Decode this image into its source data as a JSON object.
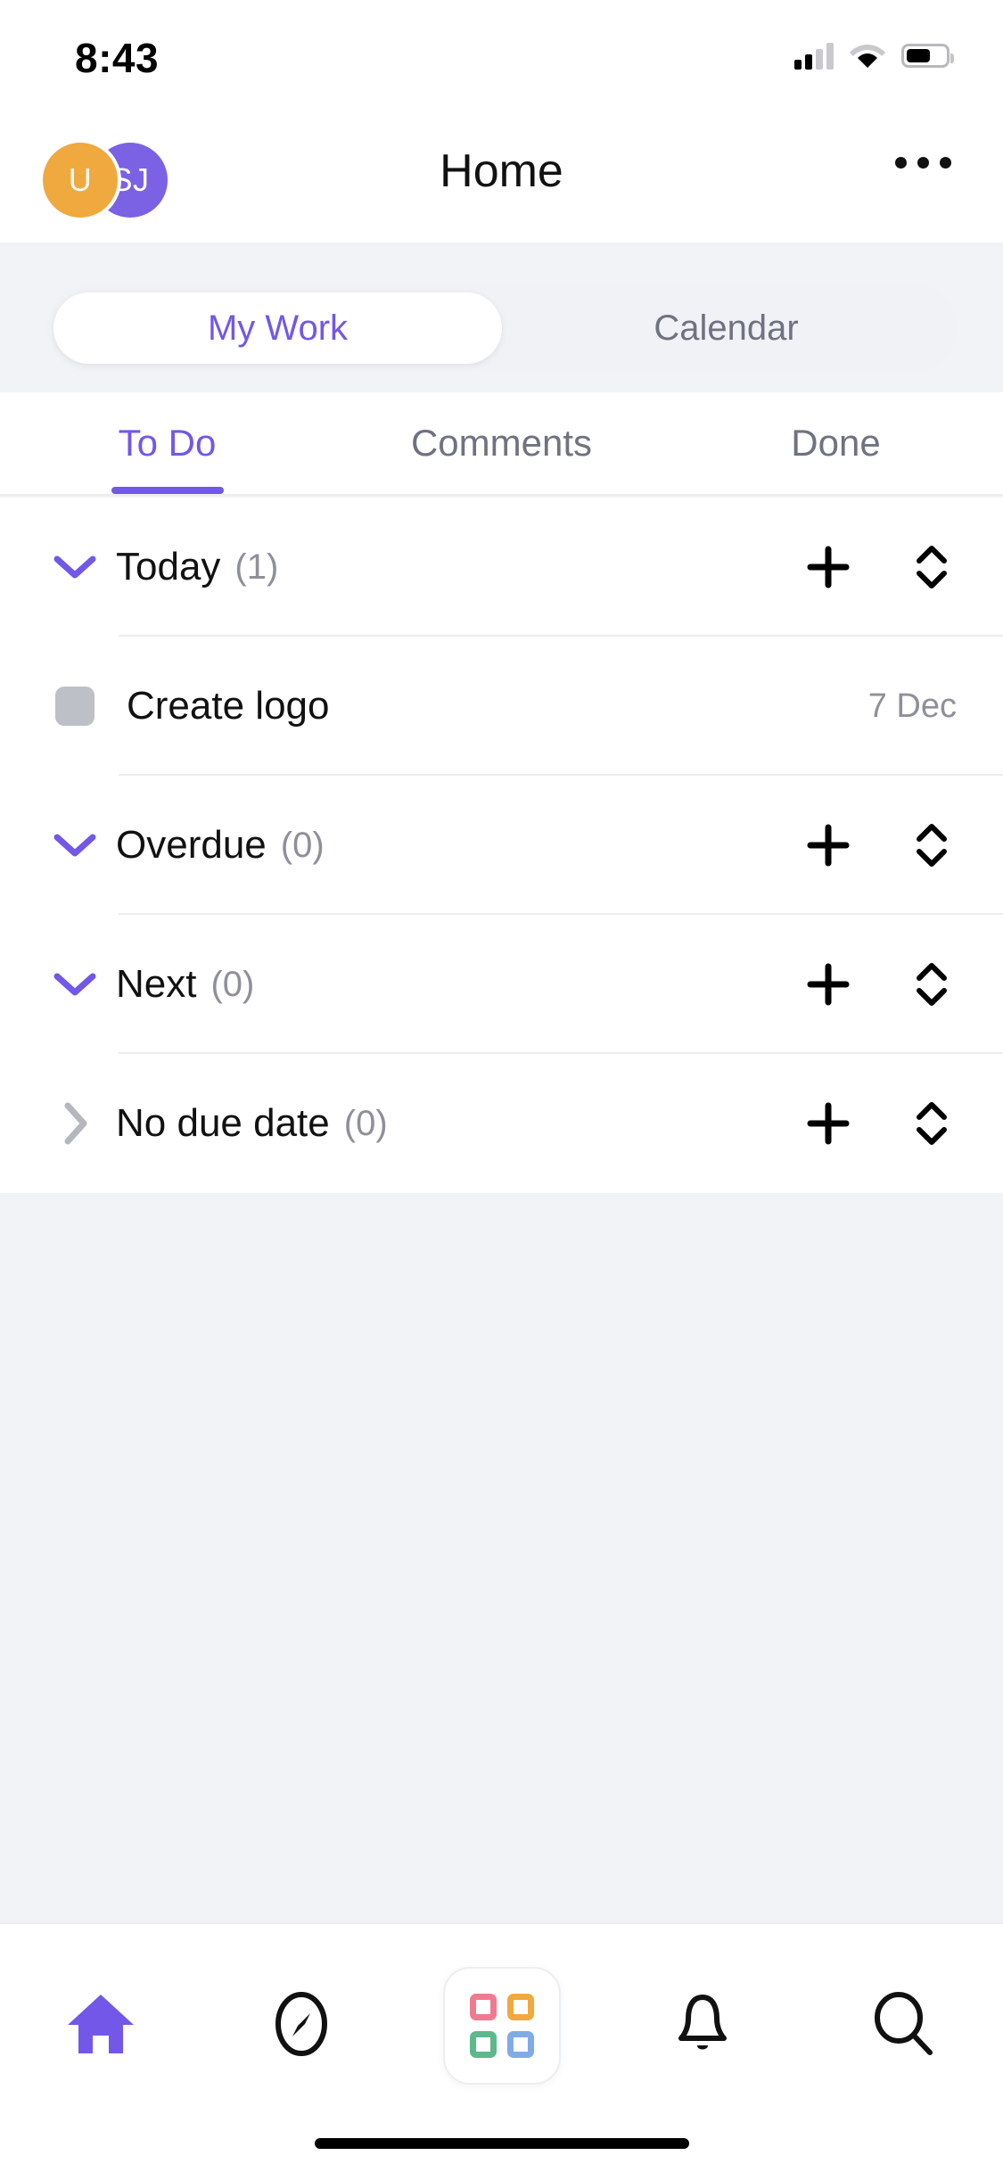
{
  "status_bar": {
    "time": "8:43",
    "icons": [
      "cellular-signal-icon",
      "wifi-icon",
      "battery-icon"
    ]
  },
  "header": {
    "title": "Home",
    "avatars": [
      {
        "initials": "U",
        "color": "#f0a93f",
        "name": "avatar-user"
      },
      {
        "initials": "SJ",
        "color": "#7b61e4",
        "name": "avatar-sj"
      }
    ],
    "more_label": "•••"
  },
  "segmented": {
    "items": [
      {
        "label": "My Work",
        "active": true
      },
      {
        "label": "Calendar",
        "active": false
      }
    ]
  },
  "subtabs": {
    "items": [
      {
        "label": "To Do",
        "active": true
      },
      {
        "label": "Comments",
        "active": false
      },
      {
        "label": "Done",
        "active": false
      }
    ]
  },
  "sections": [
    {
      "title": "Today",
      "count": "(1)",
      "expanded": true
    },
    {
      "title": "Overdue",
      "count": "(0)",
      "expanded": true
    },
    {
      "title": "Next",
      "count": "(0)",
      "expanded": true
    },
    {
      "title": "No due date",
      "count": "(0)",
      "expanded": false
    }
  ],
  "task": {
    "title": "Create logo",
    "due": "7 Dec",
    "completed": false
  },
  "row_actions": {
    "add_label": "add-task",
    "sort_label": "sort-tasks"
  },
  "bottom_nav": {
    "items": [
      {
        "name": "nav-home",
        "icon": "home-icon",
        "active": true
      },
      {
        "name": "nav-explore",
        "icon": "compass-icon",
        "active": false
      },
      {
        "name": "nav-apps",
        "icon": "apps-grid-icon",
        "active": false
      },
      {
        "name": "nav-notifications",
        "icon": "bell-icon",
        "active": false
      },
      {
        "name": "nav-search",
        "icon": "search-icon",
        "active": false
      }
    ],
    "apps_colors": [
      "#ef7b91",
      "#f0a93f",
      "#5bb98c",
      "#7fabe8"
    ]
  },
  "colors": {
    "accent": "#7357e8",
    "muted": "#8e9099",
    "background": "#f2f3f7"
  }
}
